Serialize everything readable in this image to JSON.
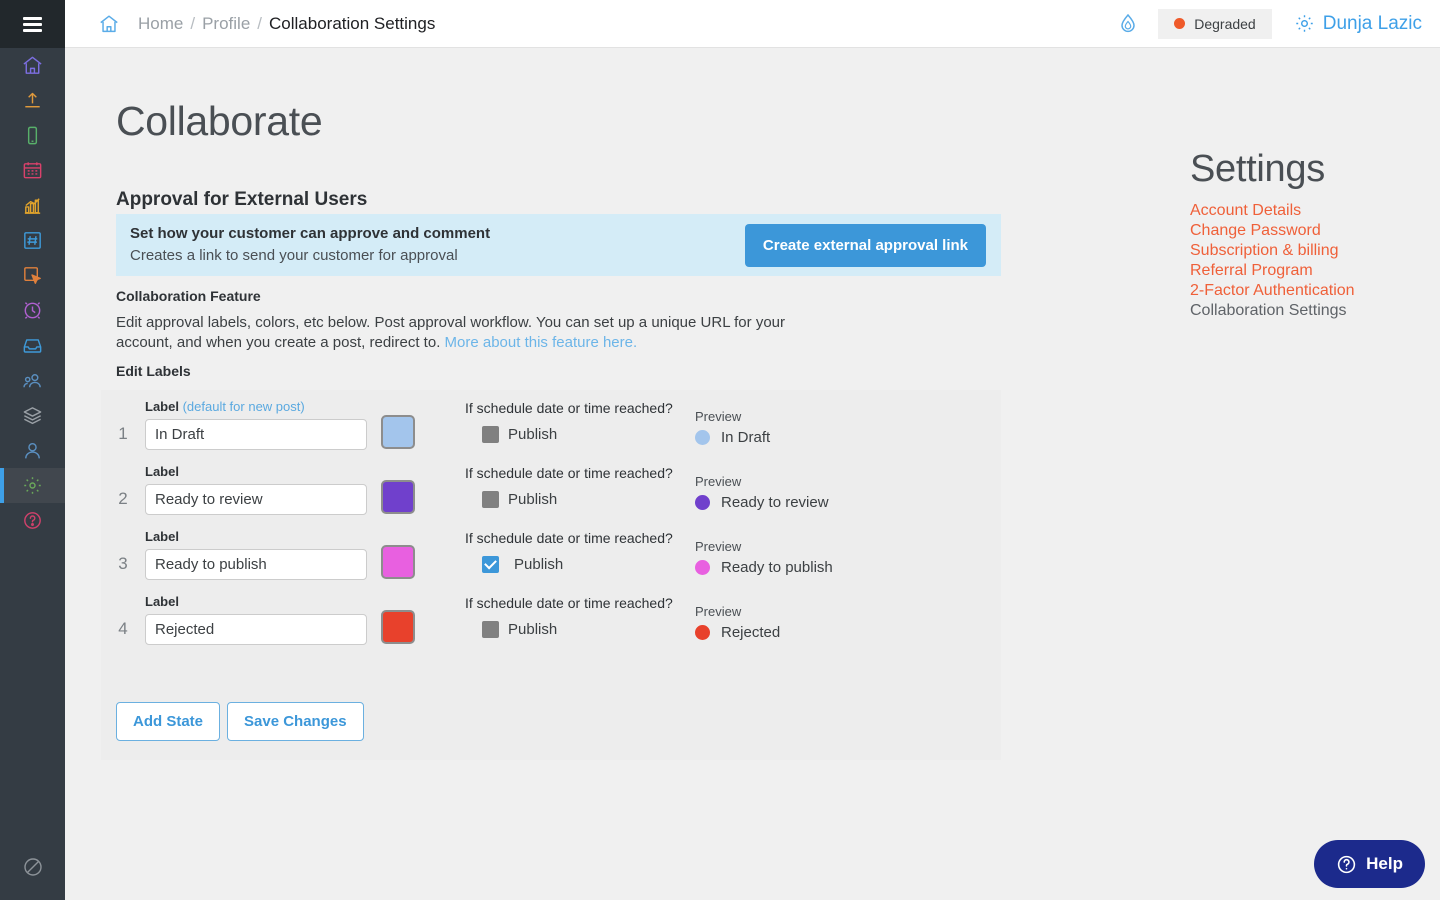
{
  "header": {
    "menu_icon": "hamburger-menu-icon",
    "home_icon": "home-icon",
    "breadcrumb": {
      "items": [
        "Home",
        "Profile"
      ],
      "separator": "/",
      "current": "Collaboration Settings"
    },
    "flame_icon": "flame-icon",
    "status": {
      "label": "Degraded",
      "dot_color": "#ef5a2a"
    },
    "user": {
      "name": "Dunja Lazic",
      "icon": "gear-icon",
      "color": "#3ea0e8"
    }
  },
  "sidebar": {
    "items": [
      {
        "name": "home",
        "icon": "home-icon",
        "color": "#7c6ee0"
      },
      {
        "name": "upload",
        "icon": "upload-icon",
        "color": "#e09a3c"
      },
      {
        "name": "mobile",
        "icon": "mobile-icon",
        "color": "#58b06a"
      },
      {
        "name": "calendar",
        "icon": "calendar-icon",
        "color": "#d9416b"
      },
      {
        "name": "analytics",
        "icon": "bar-chart-icon",
        "color": "#e0a32c"
      },
      {
        "name": "hashtag",
        "icon": "hashtag-icon",
        "color": "#3e9ad9"
      },
      {
        "name": "click",
        "icon": "cursor-click-icon",
        "color": "#e0803c"
      },
      {
        "name": "schedule",
        "icon": "clock-icon",
        "color": "#b060d0"
      },
      {
        "name": "inbox",
        "icon": "inbox-icon",
        "color": "#3e9ad9"
      },
      {
        "name": "team",
        "icon": "users-icon",
        "color": "#5a8fc0"
      },
      {
        "name": "layers",
        "icon": "layers-icon",
        "color": "#9aa0a6"
      },
      {
        "name": "profile",
        "icon": "person-icon",
        "color": "#5a8fc0"
      },
      {
        "name": "settings",
        "icon": "gear-icon",
        "color": "#6aa85a",
        "active": true
      },
      {
        "name": "help",
        "icon": "question-circle-icon",
        "color": "#d0416b"
      }
    ],
    "bottom_item": {
      "name": "blocked",
      "icon": "no-entry-icon",
      "color": "#8d9399"
    },
    "active_indicator_color": "#3ea0e8"
  },
  "main": {
    "page_title": "Collaborate",
    "section_title": "Approval for External Users",
    "banner": {
      "line1": "Set how your customer can approve and comment",
      "line2": "Creates a link to send your customer for approval",
      "button_label": "Create external approval link",
      "bg_color": "#d4ecf7",
      "button_color": "#3c97d9"
    },
    "feature": {
      "title": "Collaboration Feature",
      "description": "Edit approval labels, colors, etc below. Post approval workflow. You can set up a unique URL for your account, and when you create a post, redirect to. ",
      "link_text": "More about this feature here."
    },
    "edit_labels_title": "Edit Labels",
    "column_captions": {
      "label": "Label",
      "default_note": "(default for new post)",
      "schedule_question": "If schedule date or time reached?",
      "publish": "Publish",
      "preview": "Preview"
    },
    "rows": [
      {
        "num": "1",
        "label": "In Draft",
        "color": "#a3c5ec",
        "publish_checked": false,
        "is_default": true
      },
      {
        "num": "2",
        "label": "Ready to review",
        "color": "#7040cc",
        "publish_checked": false,
        "is_default": false
      },
      {
        "num": "3",
        "label": "Ready to publish",
        "color": "#e860e0",
        "publish_checked": true,
        "is_default": false
      },
      {
        "num": "4",
        "label": "Rejected",
        "color": "#e8412c",
        "publish_checked": false,
        "is_default": false
      }
    ],
    "buttons": {
      "add_state": "Add State",
      "save_changes": "Save Changes"
    }
  },
  "settings": {
    "heading": "Settings",
    "links": [
      {
        "label": "Account Details",
        "current": false
      },
      {
        "label": "Change Password",
        "current": false
      },
      {
        "label": "Subscription & billing",
        "current": false
      },
      {
        "label": "Referral Program",
        "current": false
      },
      {
        "label": "2-Factor Authentication",
        "current": false
      },
      {
        "label": "Collaboration Settings",
        "current": true
      }
    ],
    "link_color": "#ef6039",
    "current_color": "#5f6368"
  },
  "help": {
    "label": "Help",
    "icon": "question-circle-icon",
    "bg_color": "#1c2a8c"
  }
}
